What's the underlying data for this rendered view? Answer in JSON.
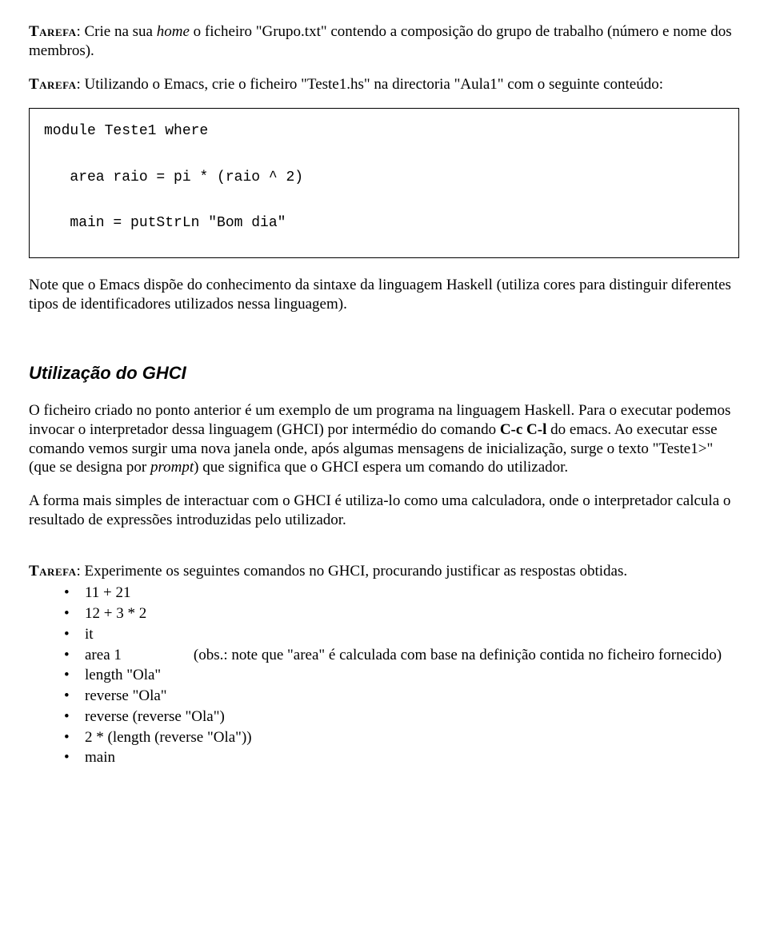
{
  "task1": {
    "label": "Tarefa",
    "before_home": ": Crie na sua ",
    "home": "home",
    "after_home": " o ficheiro \"Grupo.txt\" contendo a composição do grupo de trabalho (número e nome dos membros)."
  },
  "task2": {
    "label": "Tarefa",
    "text": ": Utilizando o Emacs, crie o ficheiro \"Teste1.hs\" na directoria \"Aula1\" com o seguinte conteúdo:"
  },
  "code": {
    "line1": "module Teste1 where",
    "line2": "   area raio = pi * (raio ^ 2)",
    "line3": "   main = putStrLn \"Bom dia\""
  },
  "note1": "Note que o Emacs dispõe do conhecimento da sintaxe da linguagem Haskell (utiliza cores para distinguir diferentes tipos de identificadores utilizados nessa linguagem).",
  "section_title": "Utilização do GHCI",
  "para1": {
    "s1": "O ficheiro criado no ponto anterior é um exemplo de um programa na linguagem Haskell. Para o executar podemos invocar o interpretador dessa linguagem (GHCI) por intermédio do comando ",
    "cc": "C-c C-l",
    "s2": " do emacs. Ao executar esse comando vemos surgir  uma nova janela onde, após algumas mensagens de inicialização, surge o texto \"Teste1>\" (que se designa por ",
    "prompt": "prompt",
    "s3": ") que significa que o GHCI espera um comando do utilizador."
  },
  "para2": "A forma mais simples de interactuar com o GHCI é utiliza-lo como uma calculadora, onde o interpretador calcula o resultado de expressões introduzidas pelo utilizador.",
  "task3": {
    "label": "Tarefa",
    "text": ": Experimente os seguintes comandos no GHCI, procurando justificar as respostas obtidas."
  },
  "items": {
    "i1": "11 + 21",
    "i2": "12 + 3 * 2",
    "i3": "it",
    "i4a": "area 1",
    "i4b": "(obs.: note que \"area\" é calculada com base na definição contida no ficheiro fornecido)",
    "i5": "length \"Ola\"",
    "i6": "reverse \"Ola\"",
    "i7": "reverse (reverse \"Ola\")",
    "i8": "2 * (length (reverse \"Ola\"))",
    "i9": "main"
  }
}
